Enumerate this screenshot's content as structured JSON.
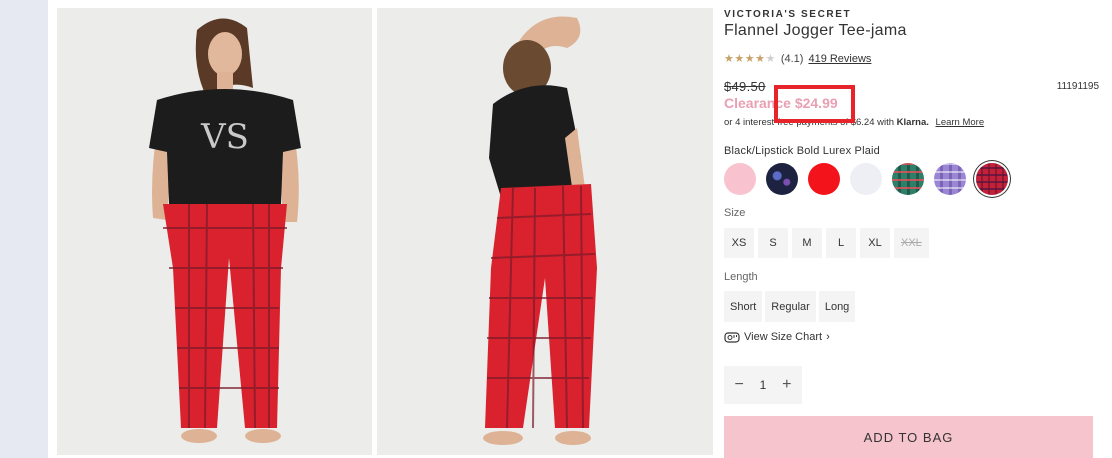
{
  "product": {
    "brand": "VICTORIA'S SECRET",
    "title": "Flannel Jogger Tee-jama",
    "rating": {
      "stars_filled": "★★★★",
      "stars_empty": "★",
      "value": "(4.1)",
      "reviews": "419 Reviews"
    },
    "price": {
      "original": "$49.50",
      "sale": "Clearance $24.99",
      "sku": "11191195"
    },
    "klarna": {
      "text": "or 4 interest-free payments of $6.24 with",
      "logo": "Klarna.",
      "learn_more": "Learn More"
    },
    "color": {
      "selected_name": "Black/Lipstick Bold Lurex Plaid",
      "swatches": [
        {
          "name": "pink",
          "color": "#f8c2cf"
        },
        {
          "name": "black-galaxy",
          "color": "#1d2240"
        },
        {
          "name": "red",
          "color": "#f2141a"
        },
        {
          "name": "white",
          "color": "#eeeff4"
        },
        {
          "name": "green-plaid",
          "color": "#2e7f68"
        },
        {
          "name": "purple-plaid",
          "color": "#9b86d4"
        },
        {
          "name": "red-plaid",
          "color": "#c4203a"
        }
      ]
    },
    "size": {
      "label": "Size",
      "options": [
        "XS",
        "S",
        "M",
        "L",
        "XL",
        "XXL"
      ]
    },
    "length": {
      "label": "Length",
      "options": [
        "Short",
        "Regular",
        "Long"
      ]
    },
    "size_chart": "View Size Chart",
    "quantity": {
      "minus": "−",
      "value": "1",
      "plus": "+"
    },
    "add_to_bag": "ADD TO BAG"
  },
  "colors": {
    "sale_pink": "#e9a0b4",
    "button_pink": "#f6c4cc",
    "highlight_red": "#e8242b",
    "star_gold": "#c8a068"
  }
}
